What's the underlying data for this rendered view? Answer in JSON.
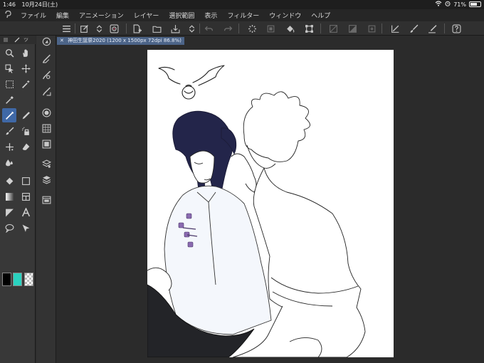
{
  "status": {
    "time": "1:46",
    "date": "10月24日(土)",
    "battery": "71%",
    "battery_level": 0.71
  },
  "menu": [
    "ファイル",
    "編集",
    "アニメーション",
    "レイヤー",
    "選択範囲",
    "表示",
    "フィルター",
    "ウィンドウ",
    "ヘルプ"
  ],
  "toolpanel": {
    "tab_label": "ツ"
  },
  "document": {
    "tab_title": "神田生誕祭2020 (1200 x 1500px 72dpi 86.8%)"
  },
  "colors": {
    "main": "#000000",
    "sub": "#2ad3c0",
    "accent": "#3f68a6",
    "button_color": "#8a6ab0"
  }
}
